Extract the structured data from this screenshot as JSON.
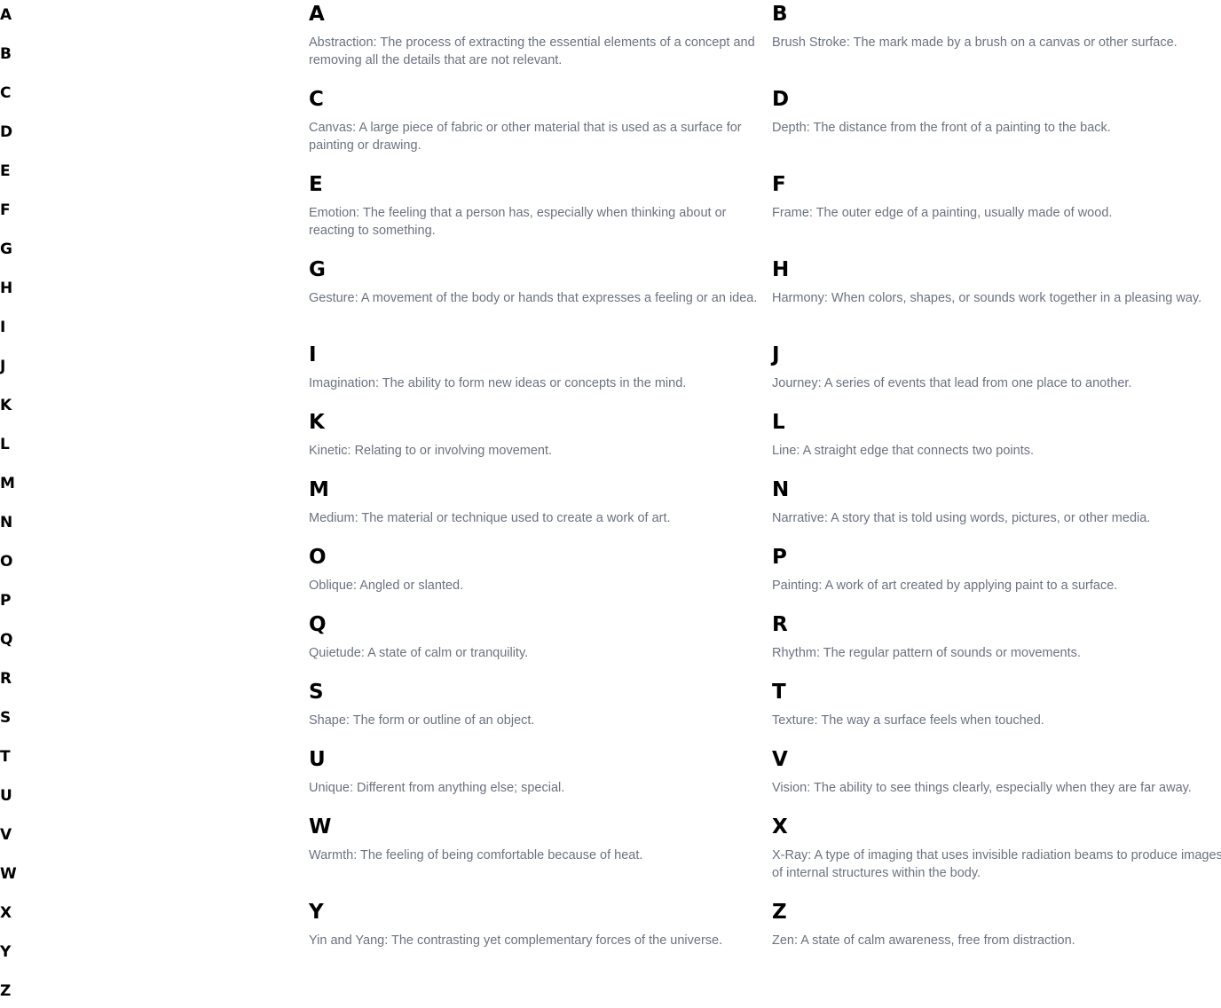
{
  "nav": {
    "letters": [
      "A",
      "B",
      "C",
      "D",
      "E",
      "F",
      "G",
      "H",
      "I",
      "J",
      "K",
      "L",
      "M",
      "N",
      "O",
      "P",
      "Q",
      "R",
      "S",
      "T",
      "U",
      "V",
      "W",
      "X",
      "Y",
      "Z"
    ]
  },
  "glossary": [
    {
      "letter": "A",
      "text": "Abstraction: The process of extracting the essential elements of a concept and removing all the details that are not relevant."
    },
    {
      "letter": "B",
      "text": "Brush Stroke: The mark made by a brush on a canvas or other surface."
    },
    {
      "letter": "C",
      "text": "Canvas: A large piece of fabric or other material that is used as a surface for painting or drawing."
    },
    {
      "letter": "D",
      "text": "Depth: The distance from the front of a painting to the back."
    },
    {
      "letter": "E",
      "text": "Emotion: The feeling that a person has, especially when thinking about or reacting to something."
    },
    {
      "letter": "F",
      "text": "Frame: The outer edge of a painting, usually made of wood."
    },
    {
      "letter": "G",
      "text": "Gesture: A movement of the body or hands that expresses a feeling or an idea."
    },
    {
      "letter": "H",
      "text": "Harmony: When colors, shapes, or sounds work together in a pleasing way."
    },
    {
      "letter": "I",
      "text": "Imagination: The ability to form new ideas or concepts in the mind."
    },
    {
      "letter": "J",
      "text": "Journey: A series of events that lead from one place to another."
    },
    {
      "letter": "K",
      "text": "Kinetic: Relating to or involving movement."
    },
    {
      "letter": "L",
      "text": "Line: A straight edge that connects two points."
    },
    {
      "letter": "M",
      "text": "Medium: The material or technique used to create a work of art."
    },
    {
      "letter": "N",
      "text": "Narrative: A story that is told using words, pictures, or other media."
    },
    {
      "letter": "O",
      "text": "Oblique: Angled or slanted."
    },
    {
      "letter": "P",
      "text": "Painting: A work of art created by applying paint to a surface."
    },
    {
      "letter": "Q",
      "text": "Quietude: A state of calm or tranquility."
    },
    {
      "letter": "R",
      "text": "Rhythm: The regular pattern of sounds or movements."
    },
    {
      "letter": "S",
      "text": "Shape: The form or outline of an object."
    },
    {
      "letter": "T",
      "text": "Texture: The way a surface feels when touched."
    },
    {
      "letter": "U",
      "text": "Unique: Different from anything else; special."
    },
    {
      "letter": "V",
      "text": "Vision: The ability to see things clearly, especially when they are far away."
    },
    {
      "letter": "W",
      "text": "Warmth: The feeling of being comfortable because of heat."
    },
    {
      "letter": "X",
      "text": "X-Ray: A type of imaging that uses invisible radiation beams to produce images of internal structures within the body."
    },
    {
      "letter": "Y",
      "text": "Yin and Yang: The contrasting yet complementary forces of the universe."
    },
    {
      "letter": "Z",
      "text": "Zen: A state of calm awareness, free from distraction."
    }
  ]
}
